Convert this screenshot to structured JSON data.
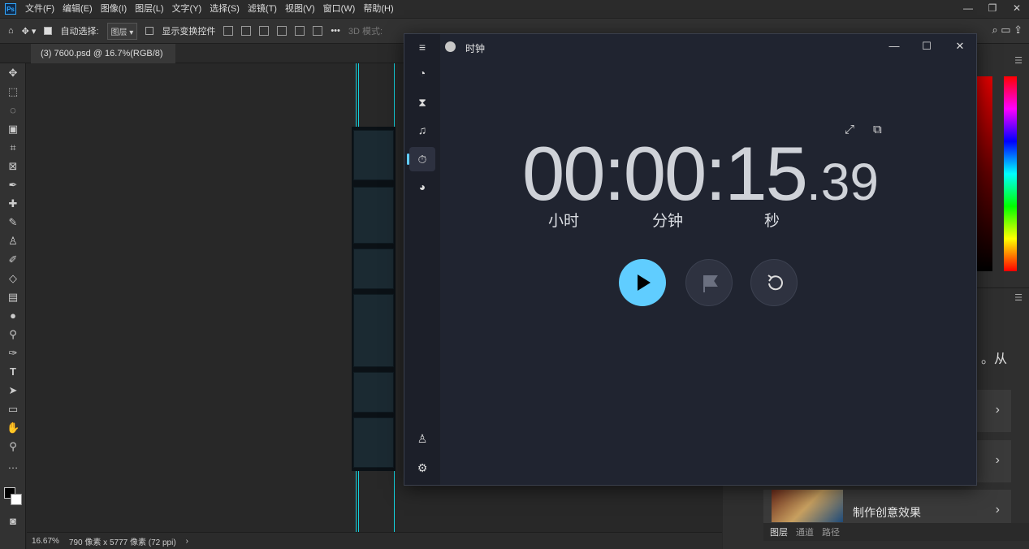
{
  "photoshop": {
    "logo": "Ps",
    "menu": [
      "文件(F)",
      "编辑(E)",
      "图像(I)",
      "图层(L)",
      "文字(Y)",
      "选择(S)",
      "滤镜(T)",
      "视图(V)",
      "窗口(W)",
      "帮助(H)"
    ],
    "window_controls": [
      "—",
      "❐",
      "✕"
    ],
    "options": {
      "auto_select_label": "自动选择:",
      "layer_select": "图层",
      "show_transform_label": "显示变换控件",
      "mode_3d_label": "3D 模式:"
    },
    "doc_tab": "(3) 7600.psd @ 16.7%(RGB/8)",
    "doc_tab_close": "×",
    "status": {
      "zoom": "16.67%",
      "dimensions": "790 像素 x 5777 像素 (72 ppi)"
    },
    "right_panel": {
      "partial_text": "。从",
      "card_label": "制作创意效果",
      "bottom_tabs": [
        "图层",
        "通道",
        "路径"
      ]
    },
    "colors": {
      "ps_accent": "#31a8ff",
      "guide": "#14d4e0"
    }
  },
  "clock": {
    "title": "时钟",
    "timer": {
      "hours": "00",
      "minutes": "00",
      "seconds": "15",
      "hundredths": "39",
      "sep": ":",
      "dot": "."
    },
    "labels": {
      "hours": "小时",
      "minutes": "分钟",
      "seconds": "秒"
    },
    "nav_icons": [
      "menu-icon",
      "focus-icon",
      "timer-icon",
      "alarm-icon",
      "stopwatch-icon",
      "world-clock-icon",
      "account-icon",
      "settings-icon"
    ],
    "colors": {
      "accent": "#60cdff",
      "background": "#202430"
    }
  }
}
